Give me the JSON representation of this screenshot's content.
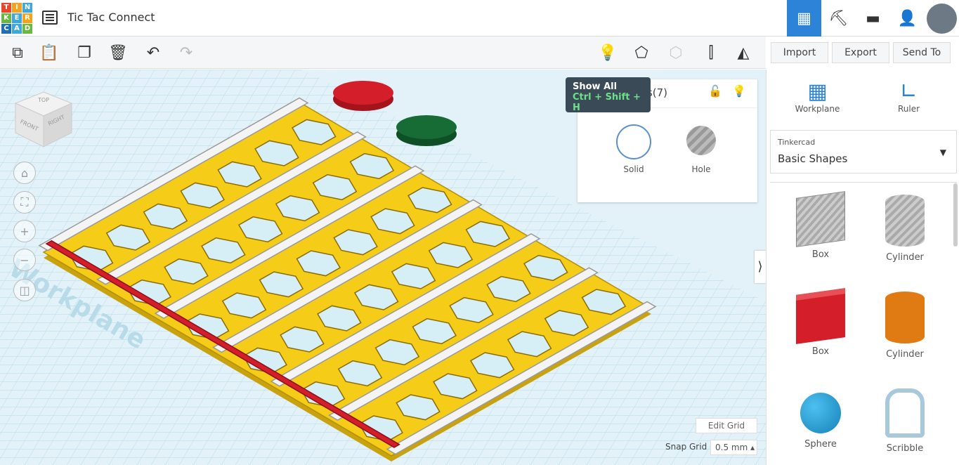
{
  "app": {
    "logo_letters": [
      "T",
      "I",
      "N",
      "K",
      "E",
      "R",
      "C",
      "A",
      "D"
    ],
    "logo_colors": [
      "#e8472a",
      "#f6a21a",
      "#3ba9dd",
      "#6bb83f",
      "#3ba9dd",
      "#f6a21a",
      "#1f6fb5",
      "#3ba9dd",
      "#6bb83f"
    ],
    "title": "Tic Tac Connect"
  },
  "toolbar": {
    "import": "Import",
    "export": "Export",
    "send_to": "Send To"
  },
  "tooltip": {
    "title": "Show All",
    "shortcut": "Ctrl + Shift + H"
  },
  "inspector": {
    "title": "Shapes(7)",
    "solid": "Solid",
    "hole": "Hole"
  },
  "viewcube": {
    "top": "TOP",
    "front": "FRONT",
    "right": "RIGHT"
  },
  "canvas": {
    "watermark": "Workplane",
    "edit_grid": "Edit Grid",
    "snap_grid_label": "Snap Grid",
    "snap_grid_value": "0.5 mm ▴"
  },
  "sidebar": {
    "workplane": "Workplane",
    "ruler": "Ruler",
    "library_source": "Tinkercad",
    "library": "Basic Shapes",
    "shapes": [
      {
        "label": "Box"
      },
      {
        "label": "Cylinder"
      },
      {
        "label": "Box"
      },
      {
        "label": "Cylinder"
      },
      {
        "label": "Sphere"
      },
      {
        "label": "Scribble"
      }
    ]
  },
  "colors": {
    "accent": "#2d83d8",
    "board": "#f5cc17",
    "red": "#d41f2b",
    "green": "#176b35"
  }
}
